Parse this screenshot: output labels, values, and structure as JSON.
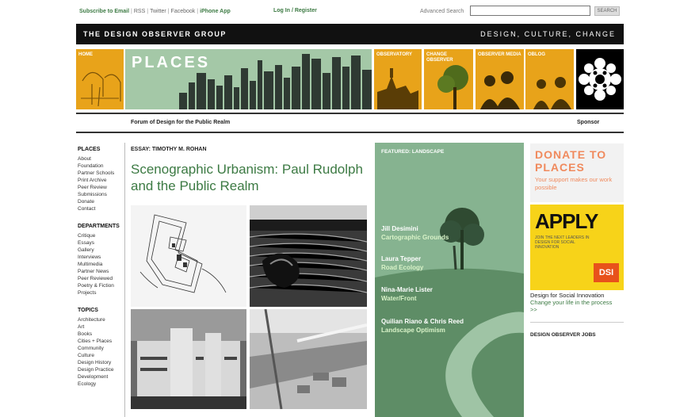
{
  "topbar": {
    "subscribe": "Subscribe to Email",
    "rss": "RSS",
    "twitter": "Twitter",
    "facebook": "Facebook",
    "iphone": "iPhone App",
    "login": "Log In / Register",
    "advanced_search": "Advanced Search",
    "search_placeholder": "",
    "search_button": "SEARCH"
  },
  "banner": {
    "left": "THE DESIGN OBSERVER GROUP",
    "right": "DESIGN, CULTURE, CHANGE"
  },
  "nav": {
    "home": "HOME",
    "places": "PLACES",
    "observatory": "OBSERVATORY",
    "change_observer": "CHANGE OBSERVER",
    "observer_media": "OBSERVER MEDIA",
    "oblog": "OBLOG"
  },
  "subheader": {
    "forum": "Forum of Design for the Public Realm",
    "sponsor": "Sponsor"
  },
  "sidebar": {
    "places_head": "PLACES",
    "places_items": [
      "About",
      "Foundation",
      "Partner Schools",
      "Print Archive",
      "Peer Review",
      "Submissions",
      "Donate",
      "Contact"
    ],
    "departments_head": "DEPARTMENTS",
    "departments_items": [
      "Critique",
      "Essays",
      "Gallery",
      "Interviews",
      "Multimedia",
      "Partner News",
      "Peer Reviewed",
      "Poetry & Fiction",
      "Projects"
    ],
    "topics_head": "TOPICS",
    "topics_items": [
      "Architecture",
      "Art",
      "Books",
      "Cities + Places",
      "Community",
      "Culture",
      "Design History",
      "Design Practice",
      "Development",
      "Ecology"
    ]
  },
  "essay": {
    "label": "ESSAY: TIMOTHY M. ROHAN",
    "title": "Scenographic Urbanism: Paul Rudolph and the Public Realm"
  },
  "featured": {
    "label": "FEATURED: LANDSCAPE",
    "items": [
      {
        "name": "Jill Desimini",
        "title": "Cartographic Grounds"
      },
      {
        "name": "Laura Tepper",
        "title": "Road Ecology"
      },
      {
        "name": "Nina-Marie Lister",
        "title": "Water/Front"
      },
      {
        "name": "Quilian Riano & Chris Reed",
        "title": "Landscape Optimism"
      }
    ]
  },
  "right": {
    "donate_title": "DONATE TO PLACES",
    "donate_sub": "Your support makes our work possible",
    "apply": "APPLY",
    "apply_sub": "JOIN THE NEXT LEADERS IN DESIGN FOR SOCIAL INNOVATION",
    "dsi_badge": "DSI",
    "dsi_title": "Design for Social Innovation",
    "dsi_link": "Change your life in the process",
    "dsi_arrow": ">>",
    "jobs": "DESIGN OBSERVER JOBS"
  },
  "colors": {
    "accent_green": "#3c7a43",
    "tile_orange": "#e8a31a",
    "featured_green": "#7fae88",
    "donate_orange": "#f08a5d",
    "apply_yellow": "#f7d319"
  }
}
